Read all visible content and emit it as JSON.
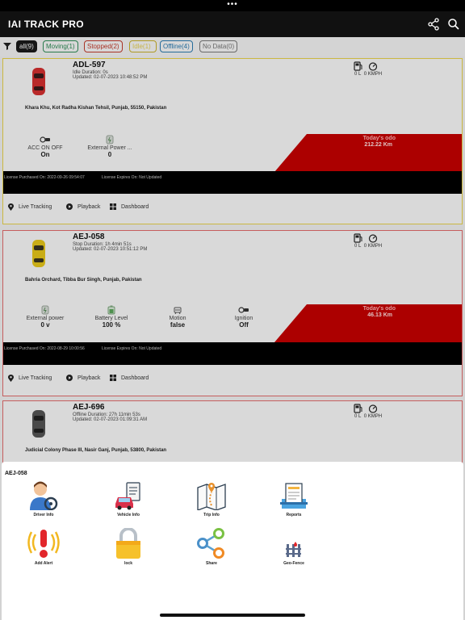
{
  "app": {
    "title": "IAI TRACK PRO"
  },
  "filters": {
    "all": "all(9)",
    "moving": "Moving(1)",
    "stopped": "Stopped(2)",
    "idle": "Idle(1)",
    "offline": "Offline(4)",
    "no_data": "No Data(0)"
  },
  "vehicles": [
    {
      "plate": "ADL-597",
      "duration": "Idle Duration: 0s",
      "updated": "Updated: 02-07-2023 10:48:52 PM",
      "address": "Khara Khu, Kot Radha Kishan Tehsil, Punjab, 55150, Pakistan",
      "fuel": "0 L",
      "speed": "0 KMPH",
      "odo_label": "Today's odo",
      "odo_value": "212.22 Km",
      "stats": [
        {
          "label": "ACC ON OFF",
          "value": "On"
        },
        {
          "label": "External Power ...",
          "value": "0"
        }
      ],
      "license_purchased": "License Purchased On: 2022-09-26 09:54:07",
      "license_expires": "License Expires On: Not Updated",
      "car_color": "#d32f2f"
    },
    {
      "plate": "AEJ-058",
      "duration": "Stop Duration: 1h 4min 51s",
      "updated": "Updated: 02-07-2023 10:51:12 PM",
      "address": "Bahria Orchard, Tibba Bur Singh, Punjab, Pakistan",
      "fuel": "0 L",
      "speed": "0 KMPH",
      "odo_label": "Today's odo",
      "odo_value": "46.13 Km",
      "stats": [
        {
          "label": "External power",
          "value": "0 v"
        },
        {
          "label": "Battery Level",
          "value": "100 %"
        },
        {
          "label": "Motion",
          "value": "false"
        },
        {
          "label": "Ignition",
          "value": "Off"
        }
      ],
      "license_purchased": "License Purchased On: 2022-08-29 10:00:56",
      "license_expires": "License Expires On: Not Updated",
      "car_color": "#e5c51a"
    },
    {
      "plate": "AEJ-696",
      "duration": "Offline Duration: 27h 11min 53s",
      "updated": "Updated: 02-07-2023 01:09:31 AM",
      "address": "Judicial Colony Phase III, Nasir Ganj, Punjab, 53800, Pakistan",
      "fuel": "0 L",
      "speed": "0 KMPH",
      "car_color": "#555555"
    }
  ],
  "card_actions": {
    "live_tracking": "Live Tracking",
    "playback": "Playback",
    "dashboard": "Dashboard"
  },
  "sheet": {
    "vehicle": "AEJ-058",
    "tiles": [
      "Driver Info",
      "Vehicle Info",
      "Trip Info",
      "Reports",
      "Add Alert",
      "lock",
      "Share",
      "Geo-Fence"
    ]
  },
  "colors": {
    "odo_red": "#c40000",
    "appbar": "#111111",
    "idle_border": "#e8d24a",
    "stopped_border": "#e26b6b"
  }
}
